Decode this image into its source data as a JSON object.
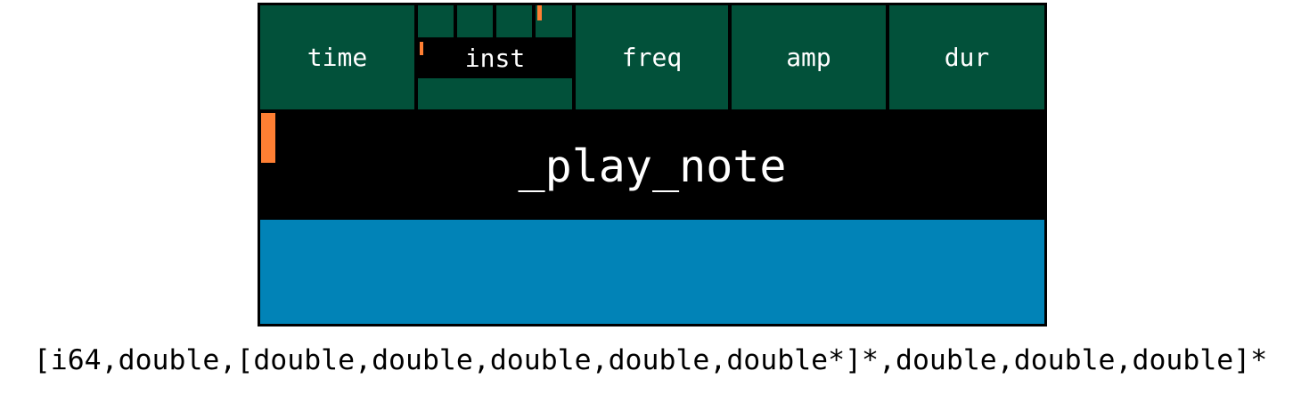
{
  "colors": {
    "field_fill": "#02513a",
    "function_fill": "#000000",
    "lower_fill": "#0183b7",
    "marker": "#ff7f33",
    "text": "#ffffff"
  },
  "fields": {
    "time": "time",
    "inst": "inst",
    "freq": "freq",
    "amp": "amp",
    "dur": "dur"
  },
  "function_name": "_play_note",
  "signature": "[i64,double,[double,double,double,double,double*]*,double,double,double]*"
}
